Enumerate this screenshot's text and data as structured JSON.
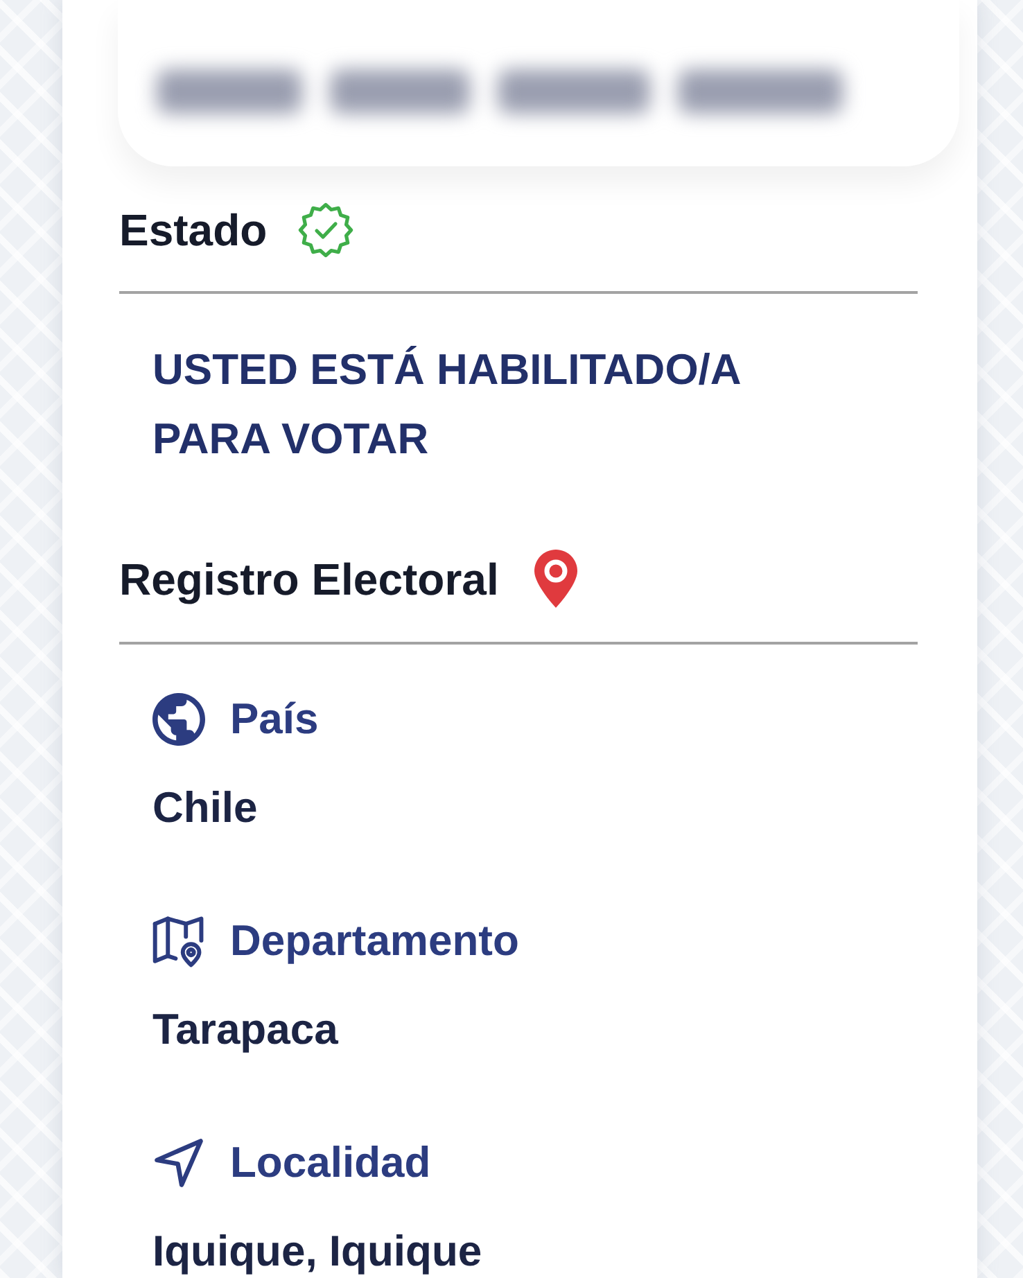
{
  "status_section": {
    "title": "Estado",
    "verified": true,
    "message": "USTED ESTÁ HABILITADO/A PARA VOTAR"
  },
  "registry_section": {
    "title": "Registro Electoral",
    "fields": [
      {
        "kind": "country",
        "label": "País",
        "value": "Chile"
      },
      {
        "kind": "department",
        "label": "Departamento",
        "value": "Tarapaca"
      },
      {
        "kind": "locality",
        "label": "Localidad",
        "value": "Iquique, Iquique"
      }
    ]
  }
}
